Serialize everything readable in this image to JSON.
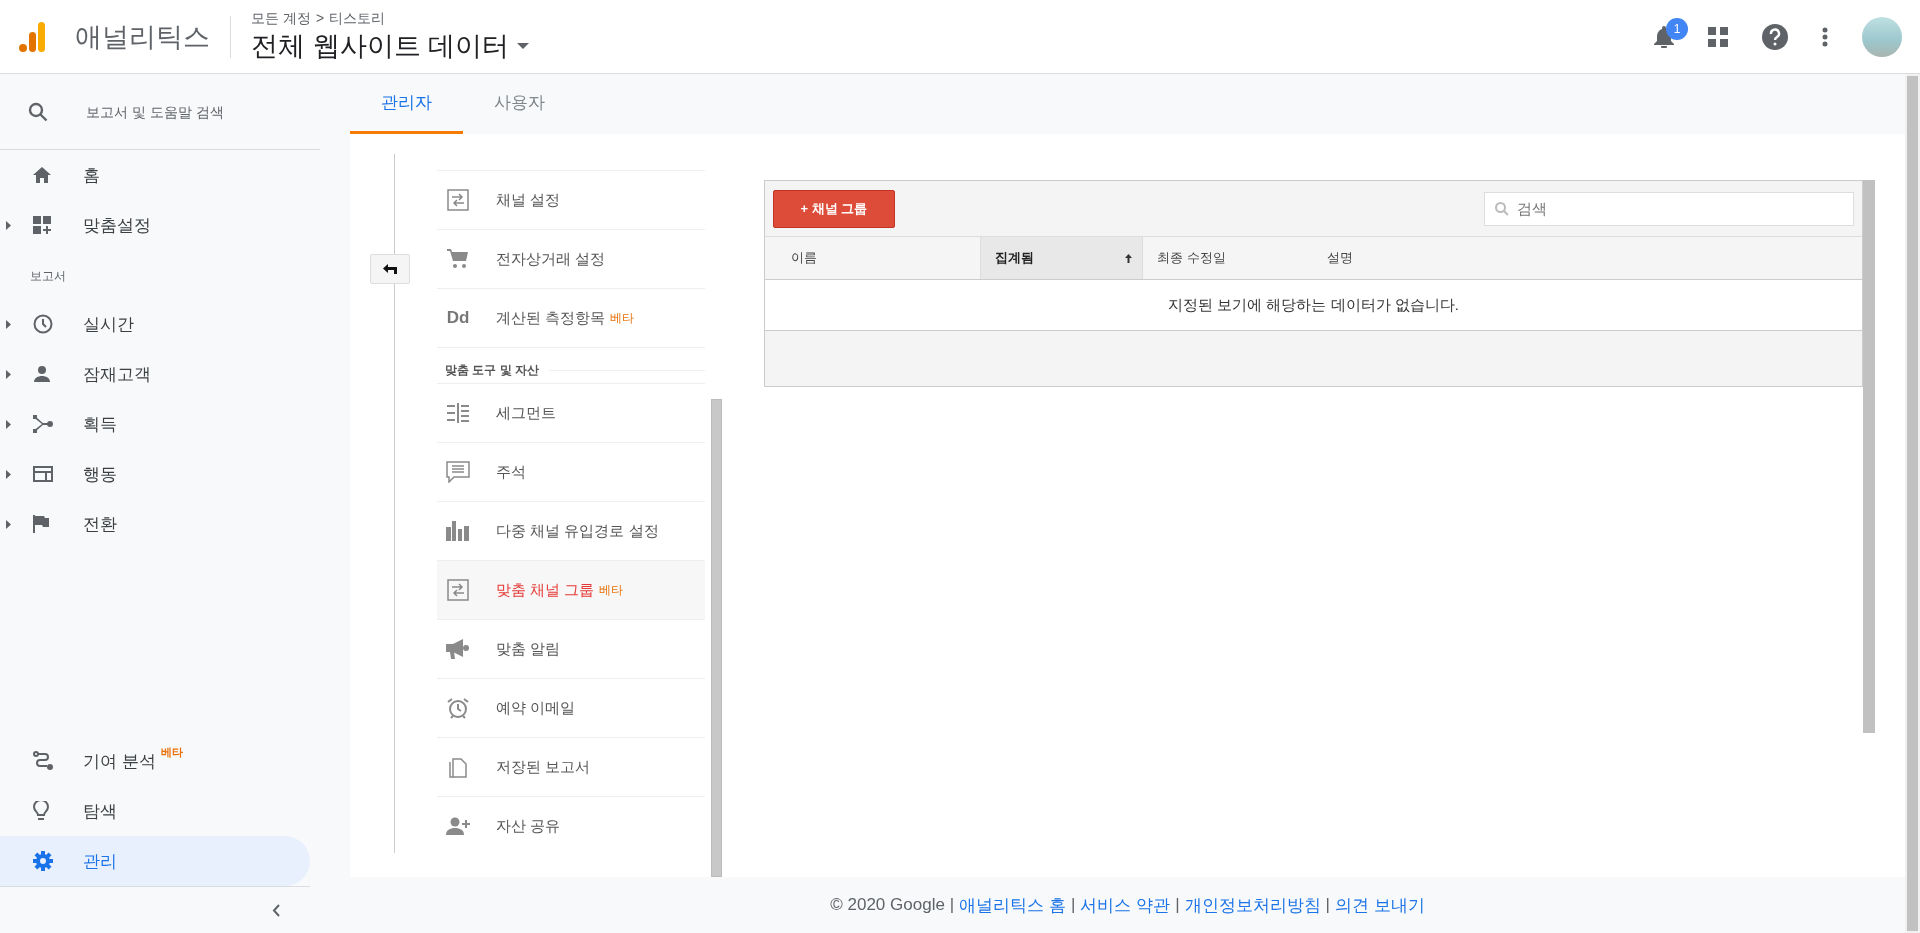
{
  "header": {
    "product": "애널리틱스",
    "breadcrumb": {
      "parent": "모든 계정",
      "separator": ">",
      "child": "티스토리"
    },
    "view_name": "전체 웹사이트 데이터",
    "notification_count": "1"
  },
  "sidebar": {
    "search_placeholder": "보고서 및 도움말 검색",
    "top_items": [
      {
        "label": "홈",
        "expandable": false,
        "selected": false
      },
      {
        "label": "맞춤설정",
        "expandable": true,
        "selected": false
      }
    ],
    "section_label": "보고서",
    "report_items": [
      {
        "label": "실시간",
        "expandable": true,
        "selected": false
      },
      {
        "label": "잠재고객",
        "expandable": true,
        "selected": false
      },
      {
        "label": "획득",
        "expandable": true,
        "selected": false
      },
      {
        "label": "행동",
        "expandable": true,
        "selected": false
      },
      {
        "label": "전환",
        "expandable": true,
        "selected": false
      }
    ],
    "bottom_items": [
      {
        "label": "기여 분석",
        "badge": "베타",
        "selected": false
      },
      {
        "label": "탐색",
        "selected": false
      },
      {
        "label": "관리",
        "selected": true
      }
    ]
  },
  "tabs": [
    {
      "label": "관리자",
      "selected": true
    },
    {
      "label": "사용자",
      "selected": false
    }
  ],
  "admin_menu": {
    "items": [
      {
        "label": "채널 설정",
        "selected": false
      },
      {
        "label": "전자상거래 설정",
        "selected": false
      },
      {
        "label": "계산된 측정항목",
        "icon_text": "Dd",
        "badge": "베타",
        "selected": false
      }
    ],
    "section_title": "맞춤 도구 및 자산",
    "section_items": [
      {
        "label": "세그먼트",
        "selected": false
      },
      {
        "label": "주석",
        "selected": false
      },
      {
        "label": "다중 채널 유입경로 설정",
        "selected": false
      },
      {
        "label": "맞춤 채널 그룹",
        "badge": "베타",
        "selected": true
      },
      {
        "label": "맞춤 알림",
        "selected": false
      },
      {
        "label": "예약 이메일",
        "selected": false
      },
      {
        "label": "저장된 보고서",
        "selected": false
      },
      {
        "label": "자산 공유",
        "selected": false
      }
    ]
  },
  "table": {
    "add_button": "+ 채널 그룹",
    "search_placeholder": "검색",
    "columns": [
      {
        "label": "이름",
        "sorted": false
      },
      {
        "label": "집계됨",
        "sorted": true
      },
      {
        "label": "최종 수정일",
        "sorted": false
      },
      {
        "label": "설명",
        "sorted": false
      }
    ],
    "empty_message": "지정된 보기에 해당하는 데이터가 없습니다."
  },
  "footer": {
    "copyright": "© 2020 Google",
    "links": [
      "애널리틱스 홈",
      "서비스 약관",
      "개인정보처리방침",
      "의견 보내기"
    ],
    "separator": "|"
  }
}
